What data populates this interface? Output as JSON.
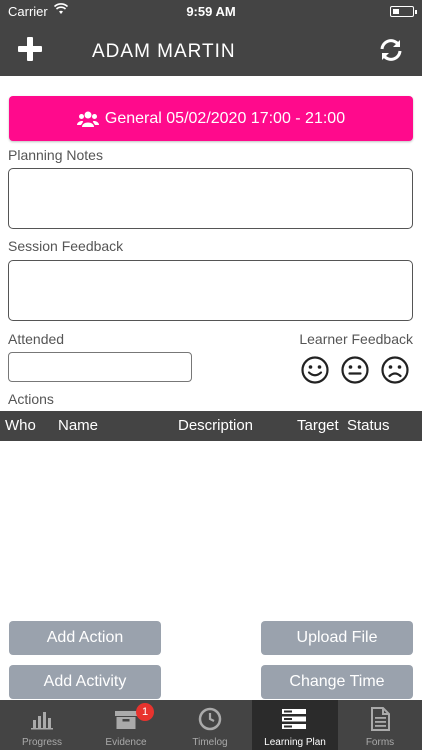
{
  "status_bar": {
    "carrier": "Carrier",
    "time": "9:59 AM"
  },
  "header": {
    "title": "ADAM MARTIN"
  },
  "session": {
    "label": "General 05/02/2020 17:00 - 21:00"
  },
  "form": {
    "planning_notes_label": "Planning Notes",
    "planning_notes_value": "",
    "session_feedback_label": "Session Feedback",
    "session_feedback_value": "",
    "attended_label": "Attended",
    "attended_value": "",
    "learner_feedback_label": "Learner Feedback",
    "faces": [
      "happy-face-icon",
      "neutral-face-icon",
      "sad-face-icon"
    ]
  },
  "actions": {
    "label": "Actions",
    "columns": [
      "Who",
      "Name",
      "Description",
      "Target",
      "Status"
    ],
    "rows": []
  },
  "buttons": {
    "add_action": "Add Action",
    "upload_file": "Upload File",
    "add_activity": "Add Activity",
    "change_time": "Change Time"
  },
  "tabs": [
    {
      "label": "Progress",
      "icon": "bar-chart-icon"
    },
    {
      "label": "Evidence",
      "icon": "archive-box-icon",
      "badge": "1"
    },
    {
      "label": "Timelog",
      "icon": "clock-icon"
    },
    {
      "label": "Learning Plan",
      "icon": "server-list-icon",
      "active": true
    },
    {
      "label": "Forms",
      "icon": "document-icon"
    }
  ],
  "colors": {
    "dark": "#444444",
    "accent": "#ff0a8c",
    "button": "#9aa2ad",
    "badge": "#e8332e"
  }
}
